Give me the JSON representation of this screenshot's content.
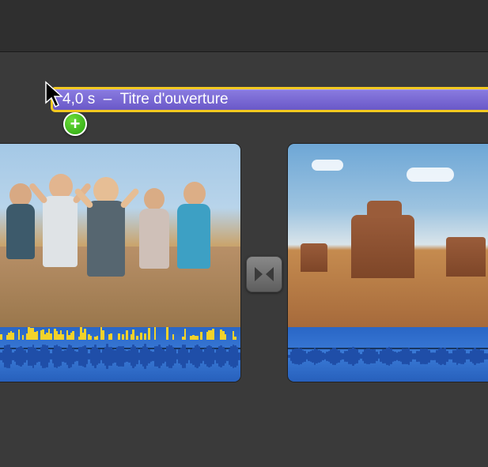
{
  "title_clip": {
    "duration_label": "4,0 s",
    "separator": "–",
    "name": "Titre d'ouverture"
  },
  "drag_indicator": {
    "icon": "plus-icon",
    "glyph": "+"
  },
  "transition": {
    "type": "cross-dissolve"
  },
  "colors": {
    "selection_border": "#f2c820",
    "title_bar": "#6a58c8",
    "audio_track": "#3a7ad6",
    "add_badge": "#2aa50e"
  }
}
